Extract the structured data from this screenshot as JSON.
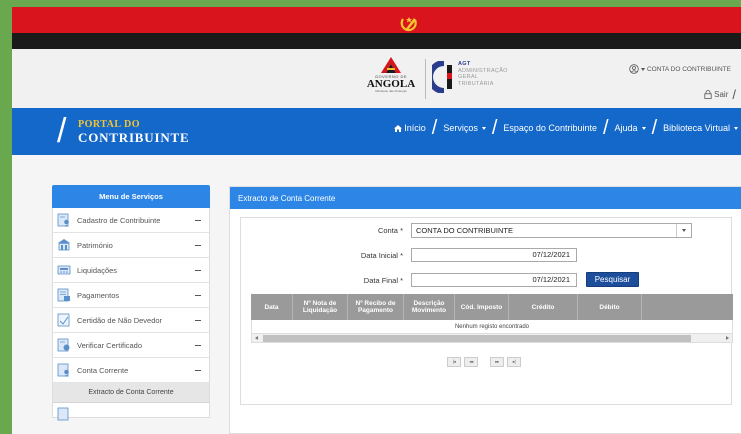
{
  "header": {
    "gov_line1": "GOVERNO DE",
    "gov_line2": "ANGOLA",
    "gov_line3": "Ministério das Finanças",
    "agt_abbr": "AGT",
    "agt_line1": "ADMINISTRAÇÃO",
    "agt_line2": "GERAL",
    "agt_line3": "TRIBUTÁRIA",
    "user_label": "CONTA DO CONTRIBUINTE",
    "sair_label": "Sair"
  },
  "portal": {
    "title_top": "PORTAL DO",
    "title_bottom": "CONTRIBUINTE"
  },
  "nav": {
    "inicio": "Início",
    "servicos": "Serviços",
    "espaco": "Espaço do Contribuinte",
    "ajuda": "Ajuda",
    "biblioteca": "Biblioteca Virtual"
  },
  "sidebar": {
    "title": "Menu de Serviços",
    "items": [
      {
        "label": "Cadastro de Contribuinte"
      },
      {
        "label": "Património"
      },
      {
        "label": "Liquidações"
      },
      {
        "label": "Pagamentos"
      },
      {
        "label": "Certidão de Não Devedor"
      },
      {
        "label": "Verificar Certificado"
      },
      {
        "label": "Conta Corrente"
      }
    ],
    "subitem": "Extracto de Conta Corrente"
  },
  "panel": {
    "title": "Extracto de Conta Corrente",
    "conta_label": "Conta",
    "conta_value": "CONTA DO CONTRIBUINTE",
    "data_inicial_label": "Data Inicial",
    "data_inicial_value": "07/12/2021",
    "data_final_label": "Data Final",
    "data_final_value": "07/12/2021",
    "required_mark": "*",
    "search_button": "Pesquisar"
  },
  "grid": {
    "columns": [
      "Data",
      "Nº Nota de Liquidação",
      "Nº Recibo de Pagamento",
      "Descrição Movimento",
      "Cód. Imposto",
      "Crédito",
      "Débito"
    ],
    "empty_message": "Nenhum registo encontrado",
    "pager": [
      "|◂",
      "◂◂",
      "▸▸",
      "▸|"
    ]
  },
  "colors": {
    "flag_red": "#d9141c",
    "flag_black": "#1a1a1a",
    "portal_blue": "#1468c9",
    "panel_blue": "#2d86e6",
    "button_navy": "#1c4e9c"
  }
}
